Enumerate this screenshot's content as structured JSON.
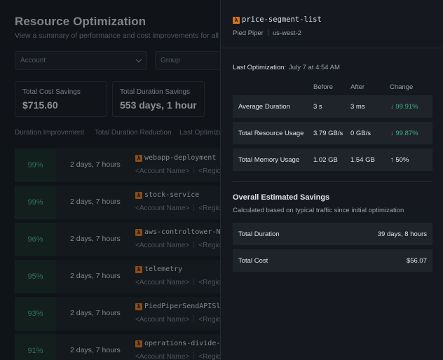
{
  "page": {
    "title": "Resource Optimization",
    "subtitle": "View a summary of performance and cost improvements for all enabled"
  },
  "filters": {
    "account_placeholder": "Account",
    "group_placeholder": "Group"
  },
  "stats": {
    "total_cost_label": "Total Cost Savings",
    "total_cost_value": "$715.60",
    "total_duration_label": "Total Duration Savings",
    "total_duration_value": "553 days, 1 hour"
  },
  "table": {
    "headers": [
      "Duration Improvement",
      "Total Duration Reduction",
      "Last Optimiza"
    ],
    "rows": [
      {
        "pct": "99%",
        "duration": "2 days, 7 hours",
        "name": "webapp-deployment",
        "account": "<Account Name>",
        "region": "<Region>"
      },
      {
        "pct": "99%",
        "duration": "2 days, 7 hours",
        "name": "stock-service",
        "account": "<Account Name>",
        "region": "<Region>"
      },
      {
        "pct": "96%",
        "duration": "2 days, 7 hours",
        "name": "aws-controltower-Not",
        "account": "<Account Name>",
        "region": "<Region>"
      },
      {
        "pct": "95%",
        "duration": "2 days, 7 hours",
        "name": "telemetry",
        "account": "<Account Name>",
        "region": "<Region>"
      },
      {
        "pct": "93%",
        "duration": "2 days, 7 hours",
        "name": "PiedPiperSendAPISlac",
        "account": "<Account Name>",
        "region": "<Region>"
      },
      {
        "pct": "91%",
        "duration": "2 days, 7 hours",
        "name": "operations-divide-jo",
        "account": "<Account Name>",
        "region": "<Region>"
      }
    ]
  },
  "panel": {
    "function_name": "price-segment-list",
    "org": "Pied Piper",
    "region": "us-west-2",
    "last_opt_label": "Last Optimization:",
    "last_opt_value": "July 7 at 4:54 AM",
    "metric_headers": {
      "before": "Before",
      "after": "After",
      "change": "Change"
    },
    "metrics": [
      {
        "label": "Average Duration",
        "before": "3 s",
        "after": "3 ms",
        "change": "↓ 99.91%",
        "good": true
      },
      {
        "label": "Total Resource Usage",
        "before": "3.79 GB/s",
        "after": "0 GB/s",
        "change": "↓ 99.87%",
        "good": true
      },
      {
        "label": "Total Memory Usage",
        "before": "1.02 GB",
        "after": "1.54 GB",
        "change": "↑ 50%",
        "good": false
      }
    ],
    "savings_title": "Overall Estimated Savings",
    "savings_subtitle": "Calculated based on typical traffic since initial optimization",
    "savings": [
      {
        "label": "Total Duration",
        "value": "39 days, 8 hours"
      },
      {
        "label": "Total Cost",
        "value": "$56.07"
      }
    ]
  },
  "colors": {
    "accent_green": "#3fae7c",
    "lambda_orange": "#d7731d",
    "background": "#15191f"
  },
  "icons": {
    "lambda": "λ",
    "chevron": "chevron-down-icon"
  }
}
